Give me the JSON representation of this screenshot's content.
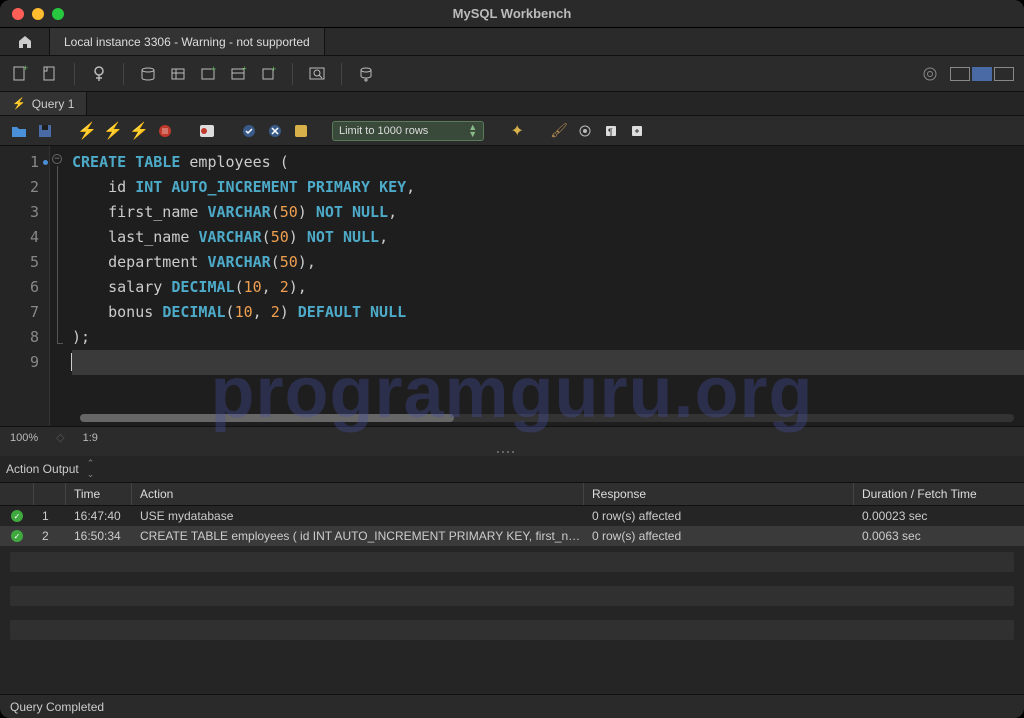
{
  "app": {
    "title": "MySQL Workbench"
  },
  "nav": {
    "connection_tab": "Local instance 3306 - Warning - not supported"
  },
  "query_tab": {
    "label": "Query 1"
  },
  "editor_toolbar": {
    "limit_label": "Limit to 1000 rows"
  },
  "code": {
    "lines": [
      {
        "n": 1,
        "tokens": [
          {
            "t": "CREATE",
            "c": "kw"
          },
          {
            "t": " "
          },
          {
            "t": "TABLE",
            "c": "kw"
          },
          {
            "t": " employees "
          },
          {
            "t": "(",
            "c": "sym"
          }
        ]
      },
      {
        "n": 2,
        "indent": 4,
        "tokens": [
          {
            "t": "id "
          },
          {
            "t": "INT",
            "c": "ty"
          },
          {
            "t": " "
          },
          {
            "t": "AUTO_INCREMENT",
            "c": "ty"
          },
          {
            "t": " "
          },
          {
            "t": "PRIMARY",
            "c": "kw"
          },
          {
            "t": " "
          },
          {
            "t": "KEY",
            "c": "kw"
          },
          {
            "t": ",",
            "c": "sym"
          }
        ]
      },
      {
        "n": 3,
        "indent": 4,
        "tokens": [
          {
            "t": "first_name "
          },
          {
            "t": "VARCHAR",
            "c": "ty"
          },
          {
            "t": "(",
            "c": "sym"
          },
          {
            "t": "50",
            "c": "num"
          },
          {
            "t": ")",
            "c": "sym"
          },
          {
            "t": " "
          },
          {
            "t": "NOT",
            "c": "kw"
          },
          {
            "t": " "
          },
          {
            "t": "NULL",
            "c": "kw"
          },
          {
            "t": ",",
            "c": "sym"
          }
        ]
      },
      {
        "n": 4,
        "indent": 4,
        "tokens": [
          {
            "t": "last_name "
          },
          {
            "t": "VARCHAR",
            "c": "ty"
          },
          {
            "t": "(",
            "c": "sym"
          },
          {
            "t": "50",
            "c": "num"
          },
          {
            "t": ")",
            "c": "sym"
          },
          {
            "t": " "
          },
          {
            "t": "NOT",
            "c": "kw"
          },
          {
            "t": " "
          },
          {
            "t": "NULL",
            "c": "kw"
          },
          {
            "t": ",",
            "c": "sym"
          }
        ]
      },
      {
        "n": 5,
        "indent": 4,
        "tokens": [
          {
            "t": "department "
          },
          {
            "t": "VARCHAR",
            "c": "ty"
          },
          {
            "t": "(",
            "c": "sym"
          },
          {
            "t": "50",
            "c": "num"
          },
          {
            "t": ")",
            "c": "sym"
          },
          {
            "t": ",",
            "c": "sym"
          }
        ]
      },
      {
        "n": 6,
        "indent": 4,
        "tokens": [
          {
            "t": "salary "
          },
          {
            "t": "DECIMAL",
            "c": "ty"
          },
          {
            "t": "(",
            "c": "sym"
          },
          {
            "t": "10",
            "c": "num"
          },
          {
            "t": ",",
            "c": "sym"
          },
          {
            "t": " "
          },
          {
            "t": "2",
            "c": "num"
          },
          {
            "t": ")",
            "c": "sym"
          },
          {
            "t": ",",
            "c": "sym"
          }
        ]
      },
      {
        "n": 7,
        "indent": 4,
        "tokens": [
          {
            "t": "bonus "
          },
          {
            "t": "DECIMAL",
            "c": "ty"
          },
          {
            "t": "(",
            "c": "sym"
          },
          {
            "t": "10",
            "c": "num"
          },
          {
            "t": ",",
            "c": "sym"
          },
          {
            "t": " "
          },
          {
            "t": "2",
            "c": "num"
          },
          {
            "t": ")",
            "c": "sym"
          },
          {
            "t": " "
          },
          {
            "t": "DEFAULT",
            "c": "kw"
          },
          {
            "t": " "
          },
          {
            "t": "NULL",
            "c": "kw"
          }
        ]
      },
      {
        "n": 8,
        "tokens": [
          {
            "t": ")",
            "c": "sym"
          },
          {
            "t": ";",
            "c": "sym"
          }
        ]
      },
      {
        "n": 9,
        "cursor": true,
        "hl": true,
        "tokens": []
      }
    ]
  },
  "editor_status": {
    "zoom": "100%",
    "pos": "1:9"
  },
  "output": {
    "mode": "Action Output",
    "cols": {
      "time": "Time",
      "action": "Action",
      "response": "Response",
      "duration": "Duration / Fetch Time"
    },
    "rows": [
      {
        "n": "1",
        "time": "16:47:40",
        "action": "USE mydatabase",
        "response": "0 row(s) affected",
        "duration": "0.00023 sec",
        "sel": false
      },
      {
        "n": "2",
        "time": "16:50:34",
        "action": "CREATE TABLE employees (     id INT AUTO_INCREMENT PRIMARY KEY,      first_n…",
        "response": "0 row(s) affected",
        "duration": "0.0063 sec",
        "sel": true
      }
    ]
  },
  "footer": {
    "status": "Query Completed"
  },
  "watermark": "programguru.org"
}
